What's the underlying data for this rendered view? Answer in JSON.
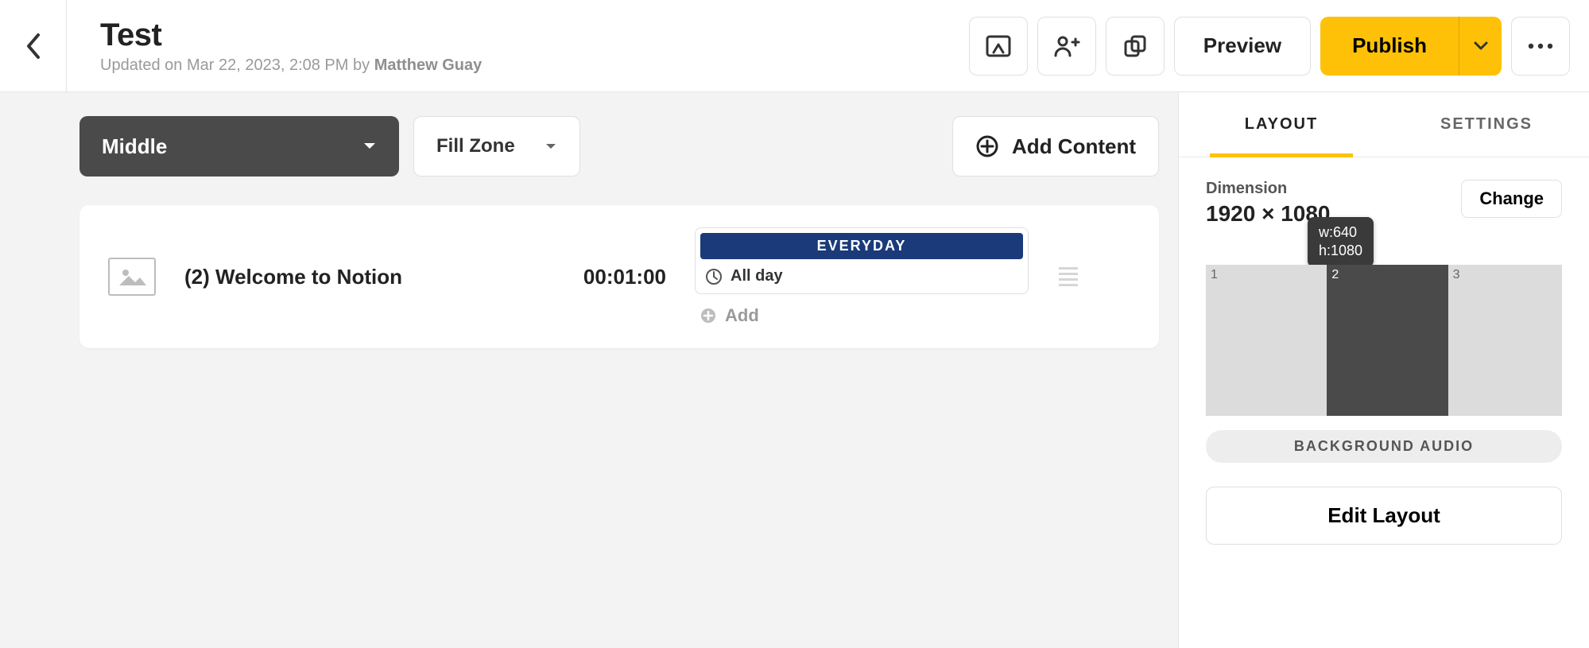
{
  "header": {
    "title": "Test",
    "meta_prefix": "Updated on ",
    "meta_date": "Mar 22, 2023, 2:08 PM",
    "meta_by": " by ",
    "author": "Matthew Guay",
    "preview": "Preview",
    "publish": "Publish"
  },
  "toolbar": {
    "zone_select": "Middle",
    "fill_select": "Fill Zone",
    "add_content": "Add Content"
  },
  "item": {
    "title": "(2) Welcome to Notion",
    "duration": "00:01:00",
    "schedule_label": "EVERYDAY",
    "allday": "All day",
    "add": "Add"
  },
  "sidebar": {
    "tabs": {
      "layout": "LAYOUT",
      "settings": "SETTINGS"
    },
    "dimension_label": "Dimension",
    "dimension_value": "1920 × 1080",
    "change": "Change",
    "tooltip": "w:640\nh:1080",
    "zones": {
      "z1": "1",
      "z2": "2",
      "z3": "3"
    },
    "bg_audio": "BACKGROUND AUDIO",
    "edit_layout": "Edit Layout"
  }
}
